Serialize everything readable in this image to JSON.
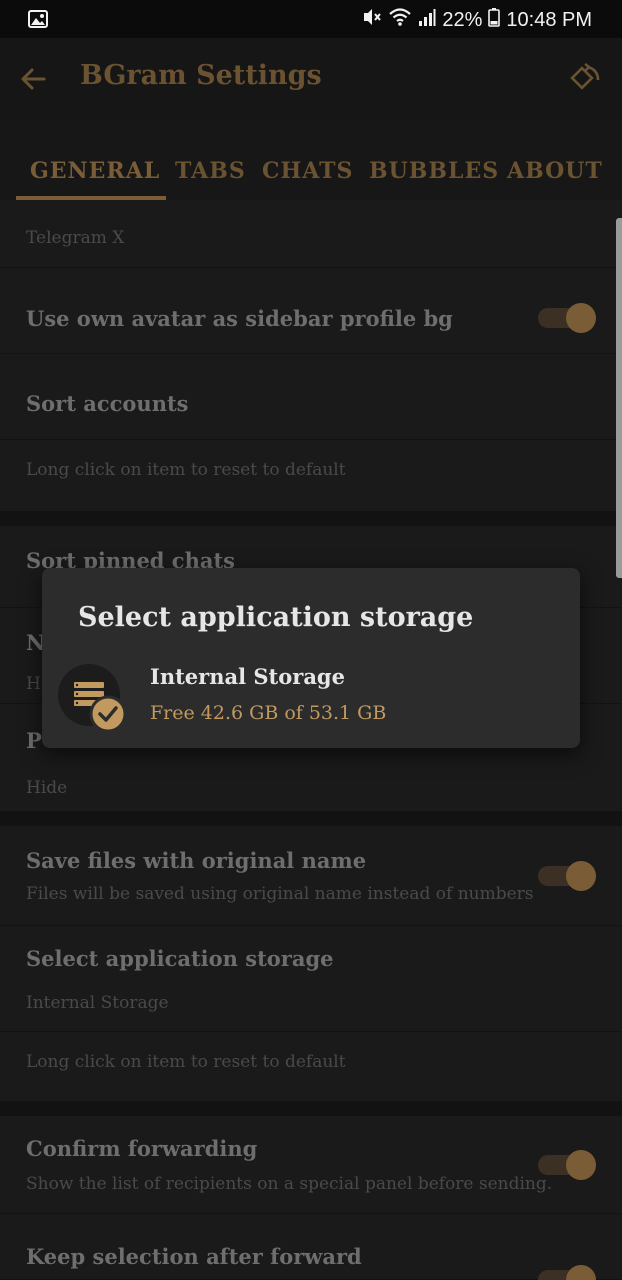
{
  "status_bar": {
    "battery": "22%",
    "time": "10:48 PM",
    "icons": [
      "gallery-icon",
      "mute-vibrate-icon",
      "wifi-icon",
      "signal-icon",
      "battery-icon"
    ]
  },
  "app_bar": {
    "title": "BGram Settings",
    "back_icon": "arrow-left-icon",
    "restore_icon": "restore-icon"
  },
  "tabs": [
    {
      "label": "GENERAL",
      "active": true
    },
    {
      "label": "TABS",
      "active": false
    },
    {
      "label": "CHATS",
      "active": false
    },
    {
      "label": "BUBBLES",
      "active": false
    },
    {
      "label": "ABOUT",
      "active": false
    }
  ],
  "settings": {
    "drawer_animation_value": "Telegram X",
    "own_avatar_label": "Use own avatar as sidebar profile bg",
    "sort_accounts_label": "Sort accounts",
    "reset_hint_1": "Long click on item to reset to default",
    "sort_pinned_label": "Sort pinned chats",
    "n_row_label": "N",
    "n_row_sub": "H",
    "p_row_label": "P",
    "p_row_value": "Hide",
    "save_files_label": "Save files with original name",
    "save_files_sub": "Files will be saved using original name instead of numbers",
    "app_storage_label": "Select application storage",
    "app_storage_value": "Internal Storage",
    "reset_hint_2": "Long click on item to reset to default",
    "confirm_forward_label": "Confirm forwarding",
    "confirm_forward_sub": "Show the list of recipients on a special panel before sending.",
    "keep_selection_label": "Keep selection after forward"
  },
  "dialog": {
    "title": "Select application storage",
    "option_name": "Internal Storage",
    "option_free": "Free 42.6 GB of 53.1 GB",
    "option_icon": "storage-check-icon"
  },
  "colors": {
    "accent": "#c29a60",
    "accent_dim": "#7a5d37",
    "background": "#1e1e1e",
    "dialog": "#2c2c2c"
  }
}
